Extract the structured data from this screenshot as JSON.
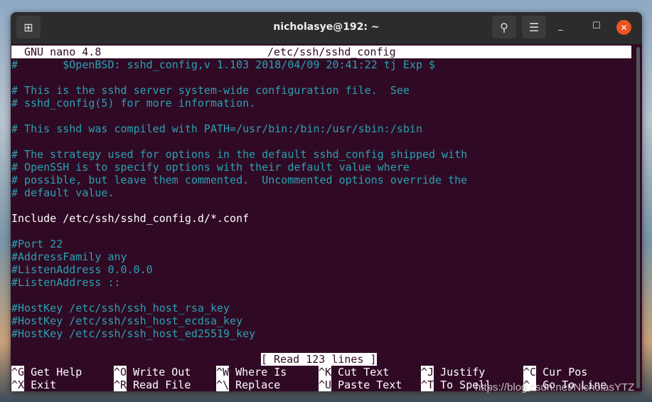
{
  "window": {
    "title": "nicholasye@192: ~"
  },
  "nano": {
    "version": "GNU nano 4.8",
    "filename": "/etc/ssh/sshd_config",
    "status": "[ Read 123 lines ]"
  },
  "lines": [
    {
      "t": "#       $OpenBSD: sshd_config,v 1.103 2018/04/09 20:41:22 tj Exp $",
      "c": true
    },
    {
      "t": "",
      "c": false
    },
    {
      "t": "# This is the sshd server system-wide configuration file.  See",
      "c": true
    },
    {
      "t": "# sshd_config(5) for more information.",
      "c": true
    },
    {
      "t": "",
      "c": false
    },
    {
      "t": "# This sshd was compiled with PATH=/usr/bin:/bin:/usr/sbin:/sbin",
      "c": true
    },
    {
      "t": "",
      "c": false
    },
    {
      "t": "# The strategy used for options in the default sshd_config shipped with",
      "c": true
    },
    {
      "t": "# OpenSSH is to specify options with their default value where",
      "c": true
    },
    {
      "t": "# possible, but leave them commented.  Uncommented options override the",
      "c": true
    },
    {
      "t": "# default value.",
      "c": true
    },
    {
      "t": "",
      "c": false
    },
    {
      "t": "Include /etc/ssh/sshd_config.d/*.conf",
      "c": false
    },
    {
      "t": "",
      "c": false
    },
    {
      "t": "#Port 22",
      "c": true
    },
    {
      "t": "#AddressFamily any",
      "c": true
    },
    {
      "t": "#ListenAddress 0.0.0.0",
      "c": true
    },
    {
      "t": "#ListenAddress ::",
      "c": true
    },
    {
      "t": "",
      "c": false
    },
    {
      "t": "#HostKey /etc/ssh/ssh_host_rsa_key",
      "c": true
    },
    {
      "t": "#HostKey /etc/ssh/ssh_host_ecdsa_key",
      "c": true
    },
    {
      "t": "#HostKey /etc/ssh/ssh_host_ed25519_key",
      "c": true
    }
  ],
  "shortcuts": [
    [
      {
        "k": "^G",
        "l": "Get Help"
      },
      {
        "k": "^O",
        "l": "Write Out"
      },
      {
        "k": "^W",
        "l": "Where Is"
      },
      {
        "k": "^K",
        "l": "Cut Text"
      },
      {
        "k": "^J",
        "l": "Justify"
      },
      {
        "k": "^C",
        "l": "Cur Pos"
      }
    ],
    [
      {
        "k": "^X",
        "l": "Exit"
      },
      {
        "k": "^R",
        "l": "Read File"
      },
      {
        "k": "^\\",
        "l": "Replace"
      },
      {
        "k": "^U",
        "l": "Paste Text"
      },
      {
        "k": "^T",
        "l": "To Spell"
      },
      {
        "k": "^_",
        "l": "Go To Line"
      }
    ]
  ],
  "watermark": "https://blog.csdn.net/NicholasYTZ"
}
